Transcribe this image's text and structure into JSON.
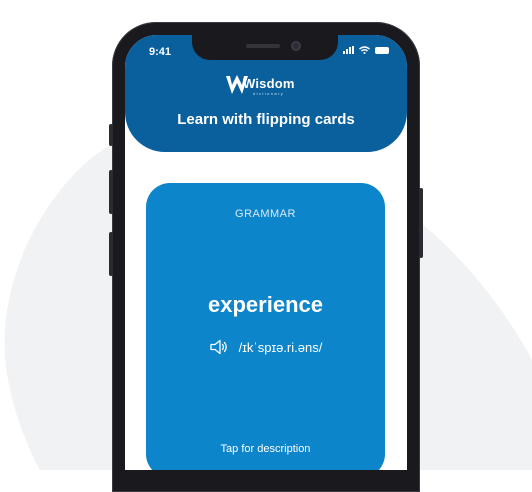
{
  "status_bar": {
    "time": "9:41",
    "icons": [
      "signal-icon",
      "wifi-icon",
      "battery-icon"
    ]
  },
  "header": {
    "logo_text": "Wisdom",
    "logo_subtext": "dictionary",
    "title": "Learn with flipping cards"
  },
  "card": {
    "category": "GRAMMAR",
    "word": "experience",
    "pronunciation": "/ɪkˈspɪə.ri.əns/",
    "hint": "Tap for description",
    "audio_icon": "speaker-icon"
  },
  "colors": {
    "header_bg": "#0a5f9d",
    "card_bg": "#0d85cb",
    "phone_frame": "#1a1a1e",
    "background_blob": "#f1f2f4"
  }
}
